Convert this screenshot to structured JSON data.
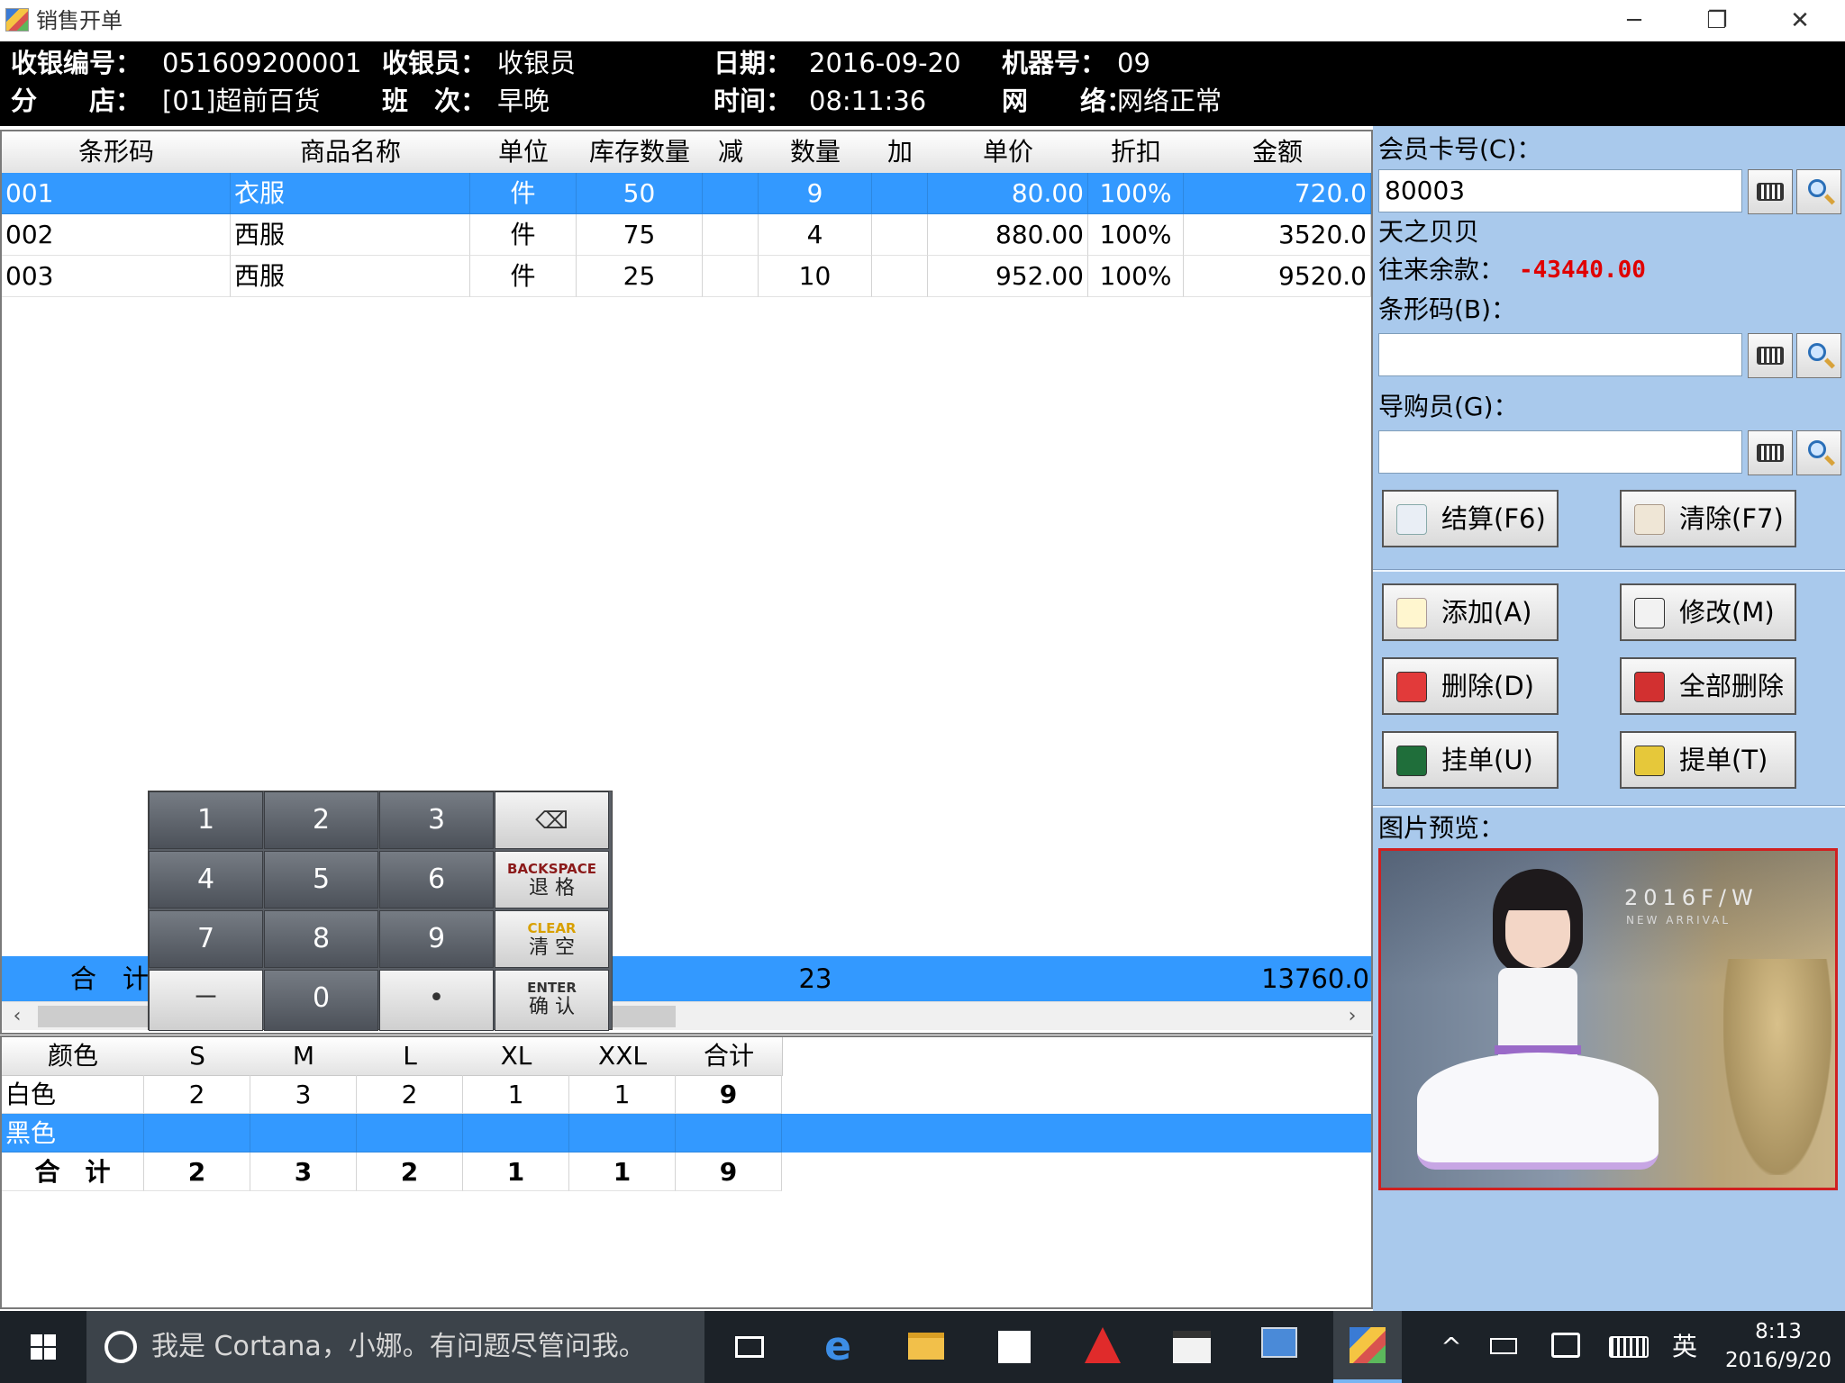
{
  "window": {
    "title": "销售开单",
    "controls": [
      "─",
      "❐",
      "✕"
    ]
  },
  "header": {
    "receipt_no_label": "收银编号：",
    "receipt_no": "051609200001",
    "cashier_label": "收银员：",
    "cashier": "收银员",
    "date_label": "日期：",
    "date": "2016-09-20",
    "machine_label": "机器号：",
    "machine": "09",
    "branch_label": "分　　店：",
    "branch": "[01]超前百货",
    "shift_label": "班　次：",
    "shift": "早晚",
    "time_label": "时间：",
    "time": "08:11:36",
    "network_label": "网　　络：",
    "network": "网络正常"
  },
  "table": {
    "columns": [
      "条形码",
      "商品名称",
      "单位",
      "库存数量",
      "减",
      "数量",
      "加",
      "单价",
      "折扣",
      "金额"
    ],
    "rows": [
      {
        "barcode": "001",
        "name": "衣服",
        "unit": "件",
        "stock": "50",
        "minus": "",
        "qty": "9",
        "plus": "",
        "price": "80.00",
        "discount": "100%",
        "amount": "720.0"
      },
      {
        "barcode": "002",
        "name": "西服",
        "unit": "件",
        "stock": "75",
        "minus": "",
        "qty": "4",
        "plus": "",
        "price": "880.00",
        "discount": "100%",
        "amount": "3520.0"
      },
      {
        "barcode": "003",
        "name": "西服",
        "unit": "件",
        "stock": "25",
        "minus": "",
        "qty": "10",
        "plus": "",
        "price": "952.00",
        "discount": "100%",
        "amount": "9520.0"
      }
    ],
    "total_label": "合　计",
    "total_qty": "23",
    "total_amount": "13760.0"
  },
  "keypad": {
    "keys": [
      "1",
      "2",
      "3",
      "4",
      "5",
      "6",
      "7",
      "8",
      "9",
      "－",
      "0",
      "•"
    ],
    "backspace_top": "BACKSPACE",
    "backspace_bottom": "退 格",
    "clear_top": "CLEAR",
    "clear_bottom": "清 空",
    "enter_top": "ENTER",
    "enter_bottom": "确 认"
  },
  "size_grid": {
    "columns": [
      "颜色",
      "S",
      "M",
      "L",
      "XL",
      "XXL",
      "合计"
    ],
    "rows": [
      [
        "白色",
        "2",
        "3",
        "2",
        "1",
        "1",
        "9"
      ],
      [
        "黑色",
        "",
        "",
        "",
        "",
        "",
        ""
      ]
    ],
    "total": [
      "合　计",
      "2",
      "3",
      "2",
      "1",
      "1",
      "9"
    ]
  },
  "panel": {
    "member_label": "会员卡号(C)：",
    "member_value": "80003",
    "member_name": "天之贝贝",
    "balance_label": "往来余款：",
    "balance_value": "-43440.00",
    "barcode_label": "条形码(B)：",
    "barcode_value": "",
    "guide_label": "导购员(G)：",
    "guide_value": "",
    "settle_label": "结算(F6)",
    "clear_label": "清除(F7)",
    "add_label": "添加(A)",
    "modify_label": "修改(M)",
    "delete_label": "删除(D)",
    "delete_all_label": "全部删除",
    "hold_label": "挂单(U)",
    "retrieve_label": "提单(T)",
    "preview_label": "图片预览：",
    "preview_caption": "2016F/W",
    "preview_subcaption": "NEW ARRIVAL"
  },
  "taskbar": {
    "search_text": "我是 Cortana，小娜。有问题尽管问我。",
    "ime": "英",
    "time": "8:13",
    "date": "2016/9/20"
  },
  "colors": {
    "selection": "#3399ff",
    "panel_bg": "#a9c9ec",
    "header_bg": "#000000",
    "balance": "#e00000",
    "preview_border": "#d02020"
  }
}
